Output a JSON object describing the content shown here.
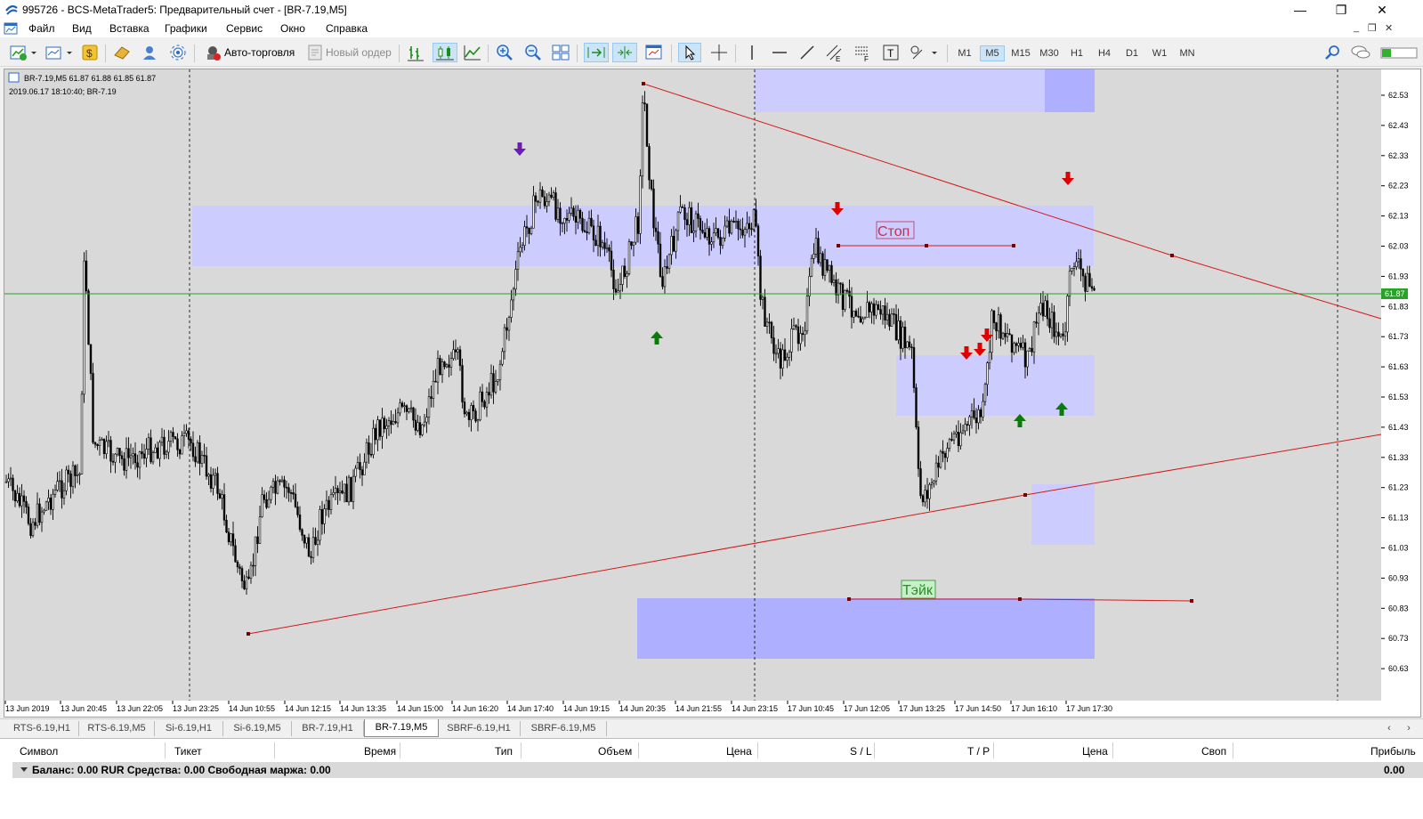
{
  "window": {
    "title": "995726 - BCS-MetaTrader5: Предварительный счет - [BR-7.19,M5]",
    "minimize": "—",
    "maximize": "❐",
    "close": "✕"
  },
  "menu": {
    "items": [
      "Файл",
      "Вид",
      "Вставка",
      "Графики",
      "Сервис",
      "Окно",
      "Справка"
    ],
    "mdi_controls": [
      "_",
      "❐",
      "✕"
    ]
  },
  "toolbar": {
    "auto_trading_label": "Авто-торговля",
    "new_order_label": "Новый ордер",
    "timeframes": [
      "M1",
      "M5",
      "M15",
      "M30",
      "H1",
      "H4",
      "D1",
      "W1",
      "MN"
    ],
    "active_timeframe": "M5"
  },
  "chart": {
    "symbol_info": "BR-7.19,M5  61.87 61.88 61.85 61.87",
    "datetime_info": "2019.06.17 18:10:40; BR-7.19",
    "current_price_label": "61.87",
    "stop_label": "Стоп",
    "take_label": "Тэйк",
    "colors": {
      "background": "#d9d9d9",
      "zone_light": "#ccccff",
      "zone_dark": "#afafff",
      "trendline": "#d41a1a",
      "bid_line": "#27a327",
      "arrow_down": "#e00000",
      "arrow_up": "#0a7a0a",
      "arrow_purple": "#6a1fb0"
    },
    "price_axis": [
      "62.53",
      "62.43",
      "62.33",
      "62.23",
      "62.13",
      "62.03",
      "61.93",
      "61.83",
      "61.73",
      "61.63",
      "61.53",
      "61.43",
      "61.33",
      "61.23",
      "61.13",
      "61.03",
      "60.93",
      "60.83",
      "60.73",
      "60.63"
    ],
    "time_axis": [
      "13 Jun 2019",
      "13 Jun 20:45",
      "13 Jun 22:05",
      "13 Jun 23:25",
      "14 Jun 10:55",
      "14 Jun 12:15",
      "14 Jun 13:35",
      "14 Jun 15:00",
      "14 Jun 16:20",
      "14 Jun 17:40",
      "14 Jun 19:15",
      "14 Jun 20:35",
      "14 Jun 21:55",
      "14 Jun 23:15",
      "17 Jun 10:45",
      "17 Jun 12:05",
      "17 Jun 13:25",
      "17 Jun 14:50",
      "17 Jun 16:10",
      "17 Jun 17:30"
    ]
  },
  "symbol_tabs": {
    "items": [
      "RTS-6.19,H1",
      "RTS-6.19,M5",
      "Si-6.19,H1",
      "Si-6.19,M5",
      "BR-7.19,H1",
      "BR-7.19,M5",
      "SBRF-6.19,H1",
      "SBRF-6.19,M5"
    ],
    "active": "BR-7.19,M5"
  },
  "terminal": {
    "columns": [
      "Символ",
      "Тикет",
      "Время",
      "Тип",
      "Объем",
      "Цена",
      "S / L",
      "T / P",
      "Цена",
      "Своп",
      "Прибыль"
    ],
    "balance_text": "Баланс: 0.00 RUR  Средства: 0.00  Свободная маржа: 0.00",
    "profit_total": "0.00"
  }
}
